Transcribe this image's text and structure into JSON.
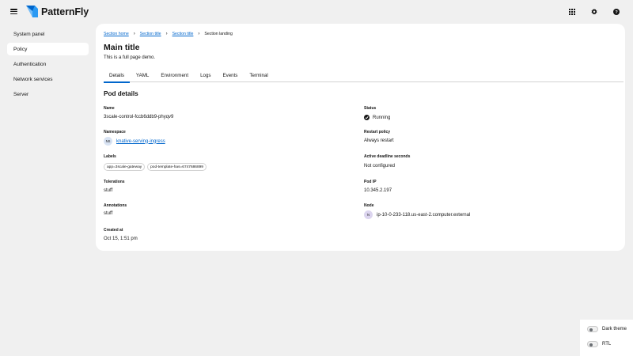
{
  "header": {
    "brand": "PatternFly",
    "icons": [
      "menu-icon",
      "grid-icon",
      "gear-icon",
      "help-icon"
    ]
  },
  "sidebar": {
    "items": [
      {
        "label": "System panel",
        "active": false
      },
      {
        "label": "Policy",
        "active": true
      },
      {
        "label": "Authentication",
        "active": false
      },
      {
        "label": "Network services",
        "active": false
      },
      {
        "label": "Server",
        "active": false
      }
    ]
  },
  "breadcrumb": {
    "items": [
      "Section home",
      "Section title",
      "Section title"
    ],
    "current": "Section landing"
  },
  "page": {
    "title": "Main title",
    "subtitle": "This is a full page demo."
  },
  "tabs": [
    {
      "label": "Details",
      "active": true
    },
    {
      "label": "YAML",
      "active": false
    },
    {
      "label": "Environment",
      "active": false
    },
    {
      "label": "Logs",
      "active": false
    },
    {
      "label": "Events",
      "active": false
    },
    {
      "label": "Terminal",
      "active": false
    }
  ],
  "details": {
    "title": "Pod details",
    "name": {
      "label": "Name",
      "value": "3scale-control-fccb6ddb9-phyqv9"
    },
    "namespace": {
      "label": "Namespace",
      "avatar": "NS",
      "value": "knative-serving-ingress"
    },
    "labels": {
      "label": "Labels",
      "chips": [
        "app=3scale-gateway",
        "pod-template-has=6747686899"
      ]
    },
    "tolerations": {
      "label": "Tolerations",
      "value": "stuff"
    },
    "annotations": {
      "label": "Annotations",
      "value": "stuff"
    },
    "created": {
      "label": "Created at",
      "value": "Oct 15, 1:51 pm"
    },
    "status": {
      "label": "Status",
      "value": "Running"
    },
    "restart": {
      "label": "Restart policy",
      "value": "Always restart"
    },
    "deadline": {
      "label": "Active deadline seconds",
      "value": "Not configured"
    },
    "pod_ip": {
      "label": "Pod IP",
      "value": "10.345.2.197"
    },
    "node": {
      "label": "Node",
      "avatar": "N",
      "value": "ip-10-0-233-118.us-east-2.computer.external"
    }
  },
  "theme_panel": {
    "dark_theme": "Dark theme",
    "rtl": "RTL"
  },
  "colors": {
    "link": "#0066cc",
    "background": "#f0f0f0",
    "card": "#ffffff"
  }
}
